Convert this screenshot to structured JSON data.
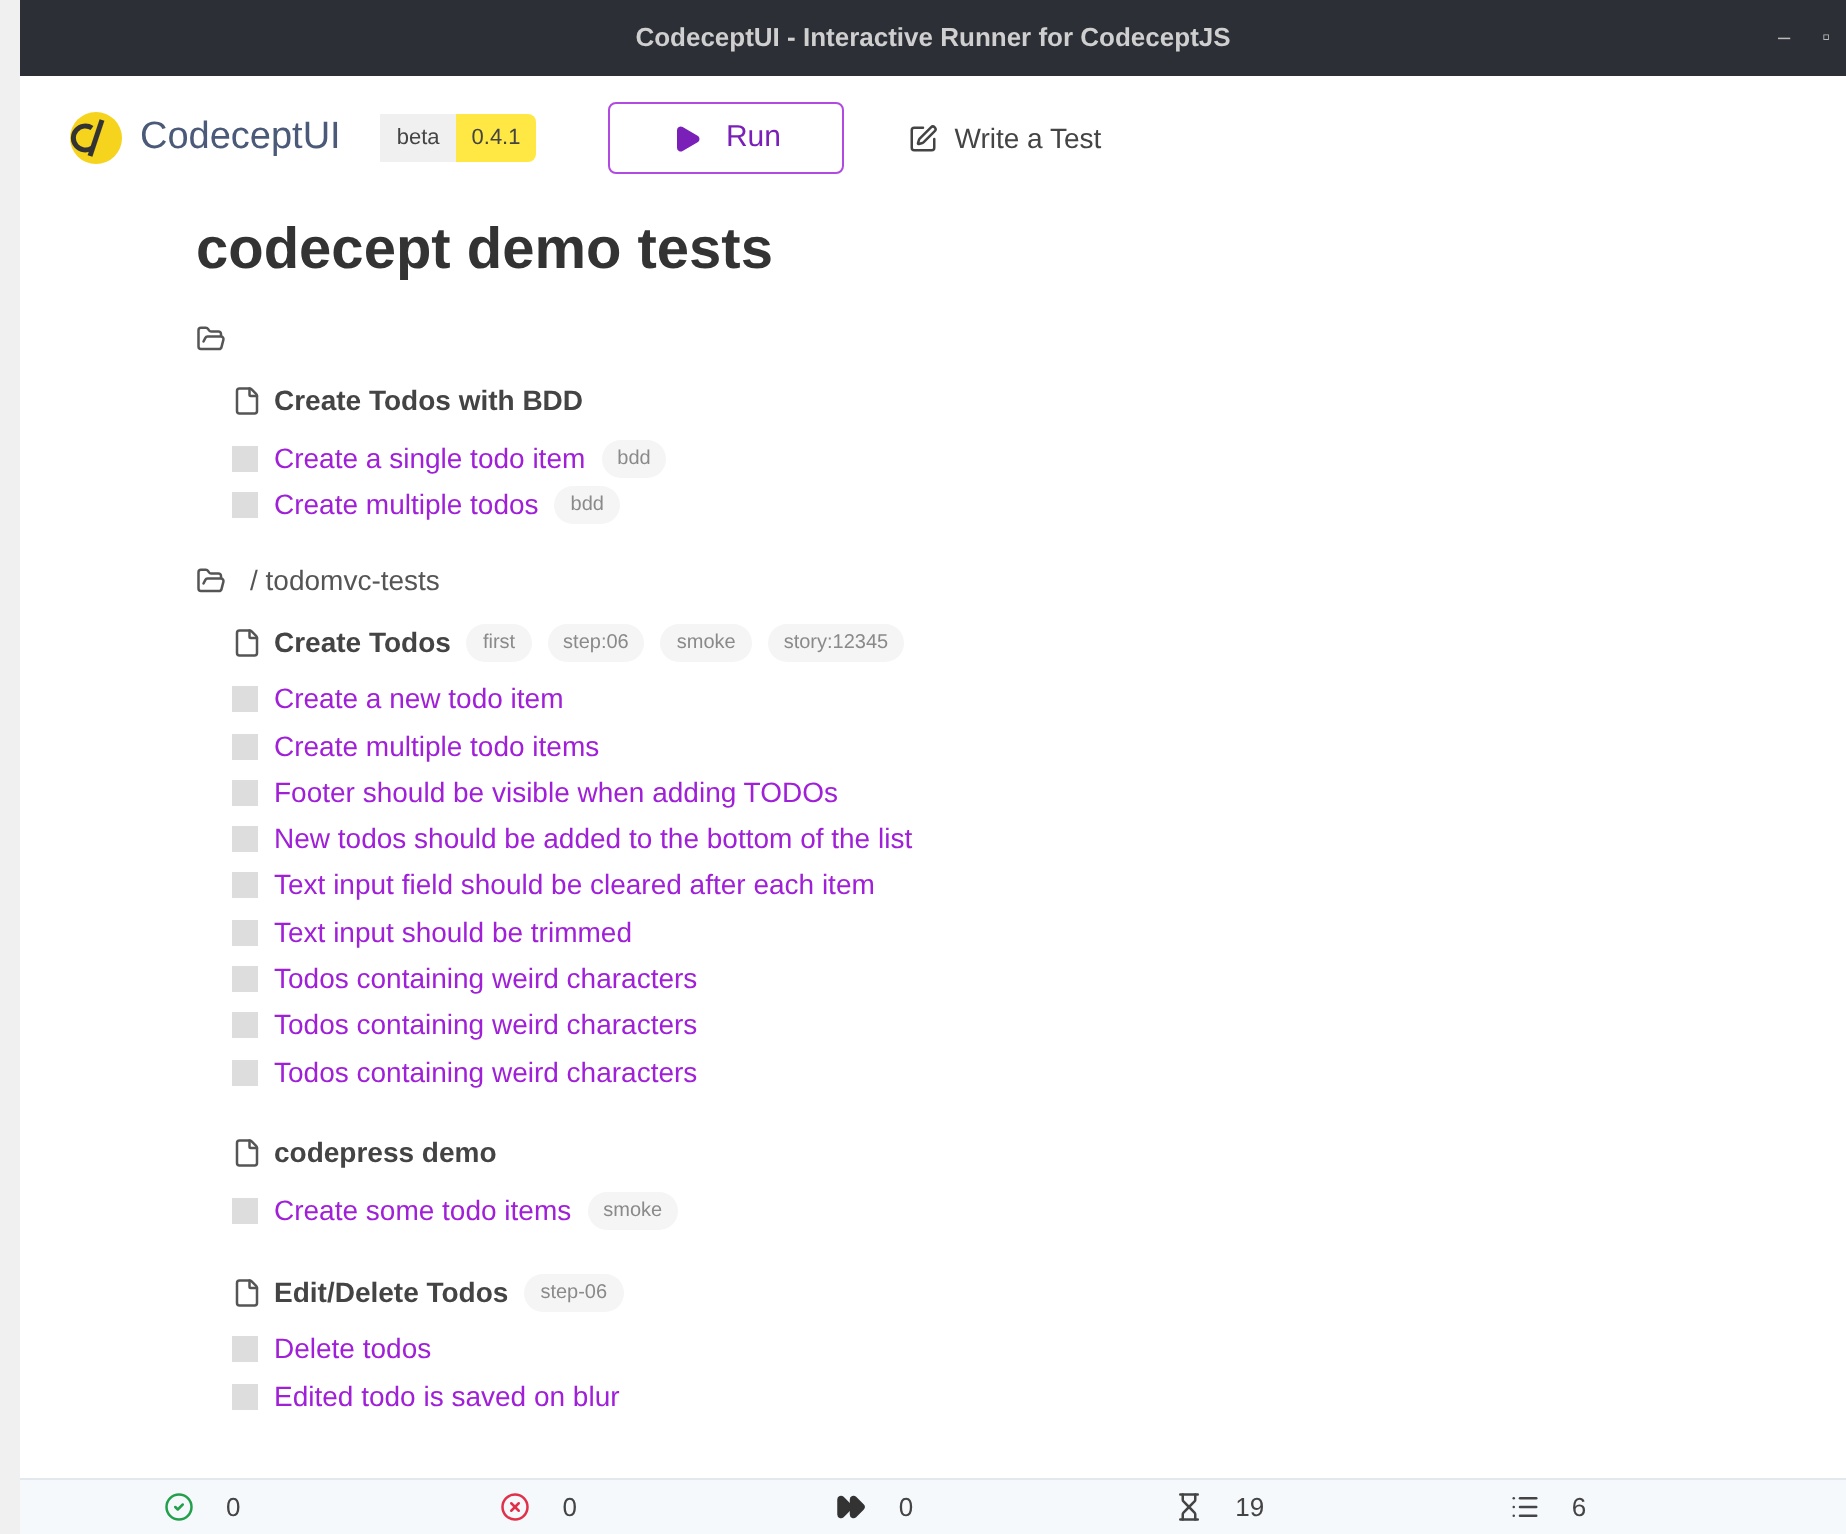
{
  "window": {
    "title": "CodeceptUI - Interactive Runner for CodeceptJS",
    "controls": [
      "–",
      "▫"
    ]
  },
  "header": {
    "logo": "CodeceptUI",
    "beta": "beta",
    "version": "0.4.1",
    "run": "Run",
    "write": "Write a Test"
  },
  "page_title": "codecept demo tests",
  "folders": [
    {
      "suites": [
        {
          "title": "Create Todos with BDD",
          "tests": [
            {
              "title": "Create a single todo item",
              "checked": false,
              "tags": [
                "bdd"
              ]
            },
            {
              "title": "Create multiple todos",
              "checked": false,
              "tags": [
                "bdd"
              ]
            }
          ]
        }
      ]
    },
    {
      "path": "/ todomvc-tests",
      "suites": [
        {
          "title": "Create Todos",
          "tags": [
            "first",
            "step:06",
            "smoke",
            "story:12345"
          ],
          "tests": [
            {
              "title": "Create a new todo item",
              "checked": false
            },
            {
              "title": "Create multiple todo items",
              "checked": false
            },
            {
              "title": "Footer should be visible when adding TODOs",
              "checked": false
            },
            {
              "title": "New todos should be added to the bottom of the list",
              "checked": false
            },
            {
              "title": "Text input field should be cleared after each item",
              "checked": false
            },
            {
              "title": "Text input should be trimmed",
              "checked": false
            },
            {
              "title": "Todos containing weird characters",
              "checked": false
            },
            {
              "title": "Todos containing weird characters",
              "checked": false
            },
            {
              "title": "Todos containing weird characters",
              "checked": false
            }
          ]
        },
        {
          "title": "codepress demo",
          "tests": [
            {
              "title": "Create some todo items",
              "checked": false,
              "tags": [
                "smoke"
              ]
            }
          ]
        },
        {
          "title": "Edit/Delete Todos",
          "tags": [
            "step-06"
          ],
          "tests": [
            {
              "title": "Delete todos",
              "checked": false
            },
            {
              "title": "Edited todo is saved on blur",
              "checked": false
            }
          ]
        }
      ]
    }
  ],
  "status_bar": [
    {
      "kind": "passed",
      "count": "0"
    },
    {
      "kind": "failed",
      "count": "0"
    },
    {
      "kind": "skipped",
      "count": "0"
    },
    {
      "kind": "pending",
      "count": "19"
    },
    {
      "kind": "total",
      "count": "6"
    }
  ]
}
